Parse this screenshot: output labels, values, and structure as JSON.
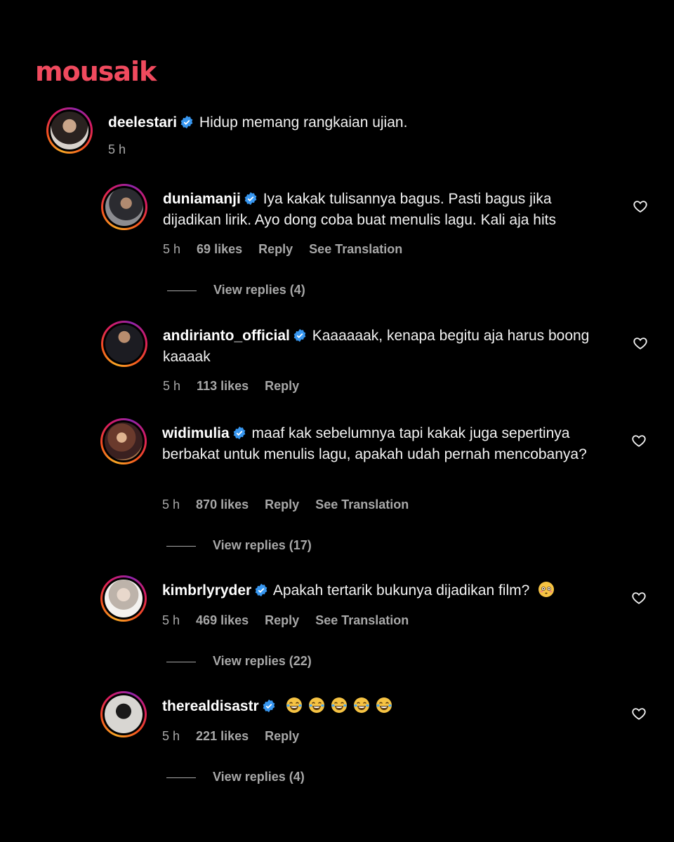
{
  "brand": {
    "logo_text": "mousaik",
    "accent_color": "#f04a5e"
  },
  "post_comment": {
    "username": "deelestari",
    "verified": true,
    "text": "Hidup memang rangkaian ujian.",
    "time": "5 h"
  },
  "replies": [
    {
      "username": "duniamanji",
      "verified": true,
      "text": "Iya kakak tulisannya bagus. Pasti bagus jika dijadikan lirik. Ayo dong coba buat menulis lagu. Kali aja hits",
      "time": "5 h",
      "likes": "69 likes",
      "reply": "Reply",
      "translate": "See Translation",
      "view_replies": "View replies (4)"
    },
    {
      "username": "andirianto_official",
      "verified": true,
      "text": "Kaaaaaak, kenapa begitu aja harus boong kaaaak",
      "time": "5 h",
      "likes": "113 likes",
      "reply": "Reply"
    },
    {
      "username": "widimulia",
      "verified": true,
      "text": "maaf kak sebelumnya tapi kakak juga sepertinya berbakat untuk menulis lagu, apakah udah pernah mencobanya?",
      "time": "5 h",
      "likes": "870 likes",
      "reply": "Reply",
      "translate": "See Translation",
      "view_replies": "View replies (17)"
    },
    {
      "username": "kimbrlyryder",
      "verified": true,
      "text": "Apakah tertarik bukunya dijadikan film?",
      "emoji": "flushed-face",
      "time": "5 h",
      "likes": "469 likes",
      "reply": "Reply",
      "translate": "See Translation",
      "view_replies": "View replies (22)"
    },
    {
      "username": "therealdisastr",
      "verified": true,
      "emoji_count": 5,
      "emoji": "tears-of-joy",
      "time": "5 h",
      "likes": "221 likes",
      "reply": "Reply",
      "view_replies": "View replies (4)"
    }
  ],
  "colors": {
    "verified_badge": "#3897f0",
    "muted_text": "#a8a8a8",
    "background": "#000000"
  }
}
